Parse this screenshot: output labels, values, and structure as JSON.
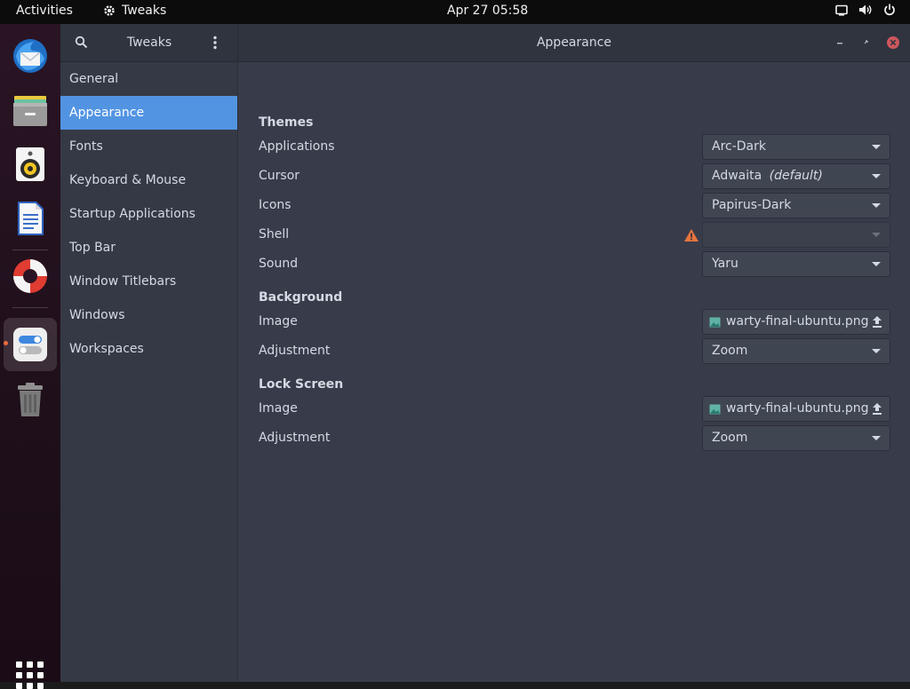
{
  "topbar": {
    "activities": "Activities",
    "app_name": "Tweaks",
    "clock": "Apr 27  05:58"
  },
  "dock": {
    "items": [
      {
        "name": "Thunderbird Mail",
        "icon": "thunderbird-icon"
      },
      {
        "name": "Files",
        "icon": "files-icon"
      },
      {
        "name": "Rhythmbox",
        "icon": "rhythmbox-icon"
      },
      {
        "name": "LibreOffice Writer",
        "icon": "writer-icon"
      },
      {
        "name": "Help",
        "icon": "help-icon"
      },
      {
        "name": "Tweaks",
        "icon": "tweaks-icon",
        "active": true
      },
      {
        "name": "Trash",
        "icon": "trash-icon"
      }
    ],
    "apps_grid_icon": "show-applications-icon"
  },
  "window": {
    "sidebar_title": "Tweaks",
    "title": "Appearance",
    "accent": "#5294e2",
    "close_color": "#cc575d"
  },
  "sidebar": {
    "items": [
      {
        "label": "General"
      },
      {
        "label": "Appearance",
        "selected": true
      },
      {
        "label": "Fonts"
      },
      {
        "label": "Keyboard & Mouse"
      },
      {
        "label": "Startup Applications"
      },
      {
        "label": "Top Bar"
      },
      {
        "label": "Window Titlebars"
      },
      {
        "label": "Windows"
      },
      {
        "label": "Workspaces"
      }
    ]
  },
  "themes": {
    "heading": "Themes",
    "applications_label": "Applications",
    "applications_value": "Arc-Dark",
    "cursor_label": "Cursor",
    "cursor_value": "Adwaita",
    "cursor_value_suffix": "(default)",
    "icons_label": "Icons",
    "icons_value": "Papirus-Dark",
    "shell_label": "Shell",
    "shell_value": "",
    "shell_warning_icon": "warning-icon",
    "sound_label": "Sound",
    "sound_value": "Yaru"
  },
  "background": {
    "heading": "Background",
    "image_label": "Image",
    "image_value": "warty-final-ubuntu.png",
    "adjustment_label": "Adjustment",
    "adjustment_value": "Zoom"
  },
  "lock_screen": {
    "heading": "Lock Screen",
    "image_label": "Image",
    "image_value": "warty-final-ubuntu.png",
    "adjustment_label": "Adjustment",
    "adjustment_value": "Zoom"
  }
}
